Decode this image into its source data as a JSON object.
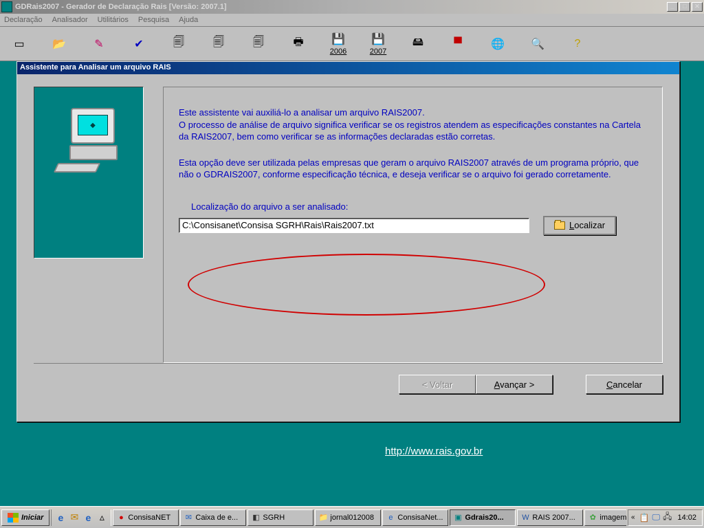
{
  "window": {
    "title": "GDRais2007 - Gerador de Declaração Rais [Versão: 2007.1]"
  },
  "menu": {
    "items": [
      "Declaração",
      "Analisador",
      "Utilitários",
      "Pesquisa",
      "Ajuda"
    ]
  },
  "toolbar": {
    "year1": "2006",
    "year2": "2007"
  },
  "dialog": {
    "title": "Assistente para Analisar um arquivo RAIS",
    "para1_l1": "Este assistente vai auxiliá-lo a analisar um arquivo RAIS2007.",
    "para1_l2": "O processo de análise de arquivo significa verificar se os registros atendem as especificações constantes na Cartela da RAIS2007, bem como verificar se as informações declaradas estão corretas.",
    "para2": "Esta opção deve ser utilizada pelas empresas que geram o arquivo RAIS2007 através de um programa próprio, que não o GDRAIS2007, conforme especificação técnica, e deseja verificar se o arquivo foi gerado corretamente.",
    "loc_label": "Localização do arquivo a ser analisado:",
    "loc_value": "C:\\Consisanet\\Consisa SGRH\\Rais\\Rais2007.txt",
    "btn_localizar": "Localizar",
    "btn_back": "< Voltar",
    "btn_next": "Avançar >",
    "btn_cancel": "Cancelar"
  },
  "url": "http://www.rais.gov.br",
  "taskbar": {
    "start": "Iniciar",
    "tasks": [
      {
        "label": "ConsisaNET",
        "pressed": false,
        "icon": "●",
        "color": "#d00000"
      },
      {
        "label": "Caixa de e...",
        "pressed": false,
        "icon": "✉",
        "color": "#2060c0"
      },
      {
        "label": "SGRH",
        "pressed": false,
        "icon": "◧",
        "color": "#303030"
      },
      {
        "label": "jornal012008",
        "pressed": false,
        "icon": "📁",
        "color": "#c09020"
      },
      {
        "label": "ConsisaNet...",
        "pressed": false,
        "icon": "e",
        "color": "#2060c0"
      },
      {
        "label": "Gdrais20...",
        "pressed": true,
        "icon": "▣",
        "color": "#008080"
      },
      {
        "label": "RAIS 2007...",
        "pressed": false,
        "icon": "W",
        "color": "#2050a0"
      },
      {
        "label": "imagem - P...",
        "pressed": false,
        "icon": "✿",
        "color": "#40a040"
      }
    ],
    "clock": "14:02",
    "tray_chevron": "«"
  }
}
